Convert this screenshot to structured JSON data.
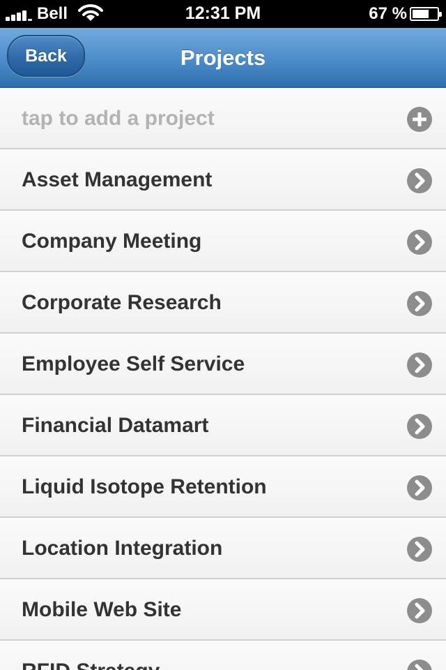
{
  "status_bar": {
    "carrier": "Bell",
    "time": "12:31 PM",
    "battery_percent": "67 %",
    "battery_level": 0.67
  },
  "nav_bar": {
    "back_label": "Back",
    "title": "Projects"
  },
  "list": {
    "add_placeholder": "tap to add a project",
    "add_icon": "plus-circle-icon",
    "item_icon": "chevron-circle-icon",
    "items": [
      "Asset Management",
      "Company Meeting",
      "Corporate Research",
      "Employee Self Service",
      "Financial Datamart",
      "Liquid Isotope Retention",
      "Location Integration",
      "Mobile Web Site",
      "RFID Strategy"
    ]
  }
}
